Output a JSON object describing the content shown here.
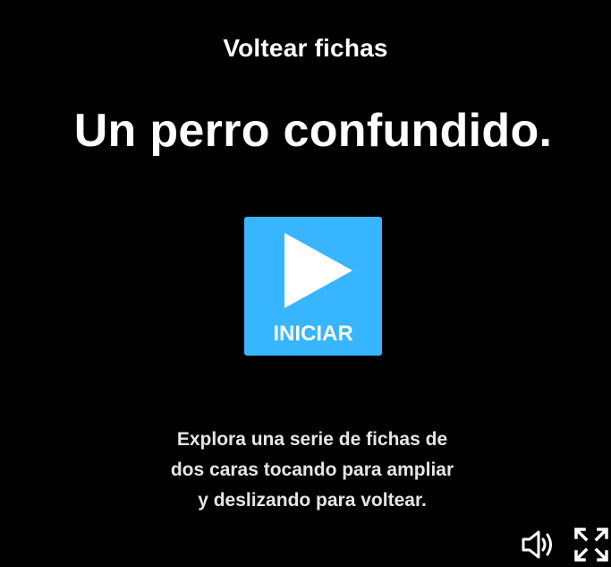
{
  "activity": {
    "type_label": "Voltear fichas",
    "title": "Un perro confundido.",
    "start_label": "INICIAR",
    "instructions": "Explora una serie de fichas de\ndos caras tocando para ampliar\ny deslizando para voltear."
  },
  "controls": {
    "volume_icon": "volume-icon",
    "fullscreen_icon": "fullscreen-icon"
  },
  "colors": {
    "background": "#000000",
    "accent": "#37b6ff",
    "text": "#ffffff"
  }
}
